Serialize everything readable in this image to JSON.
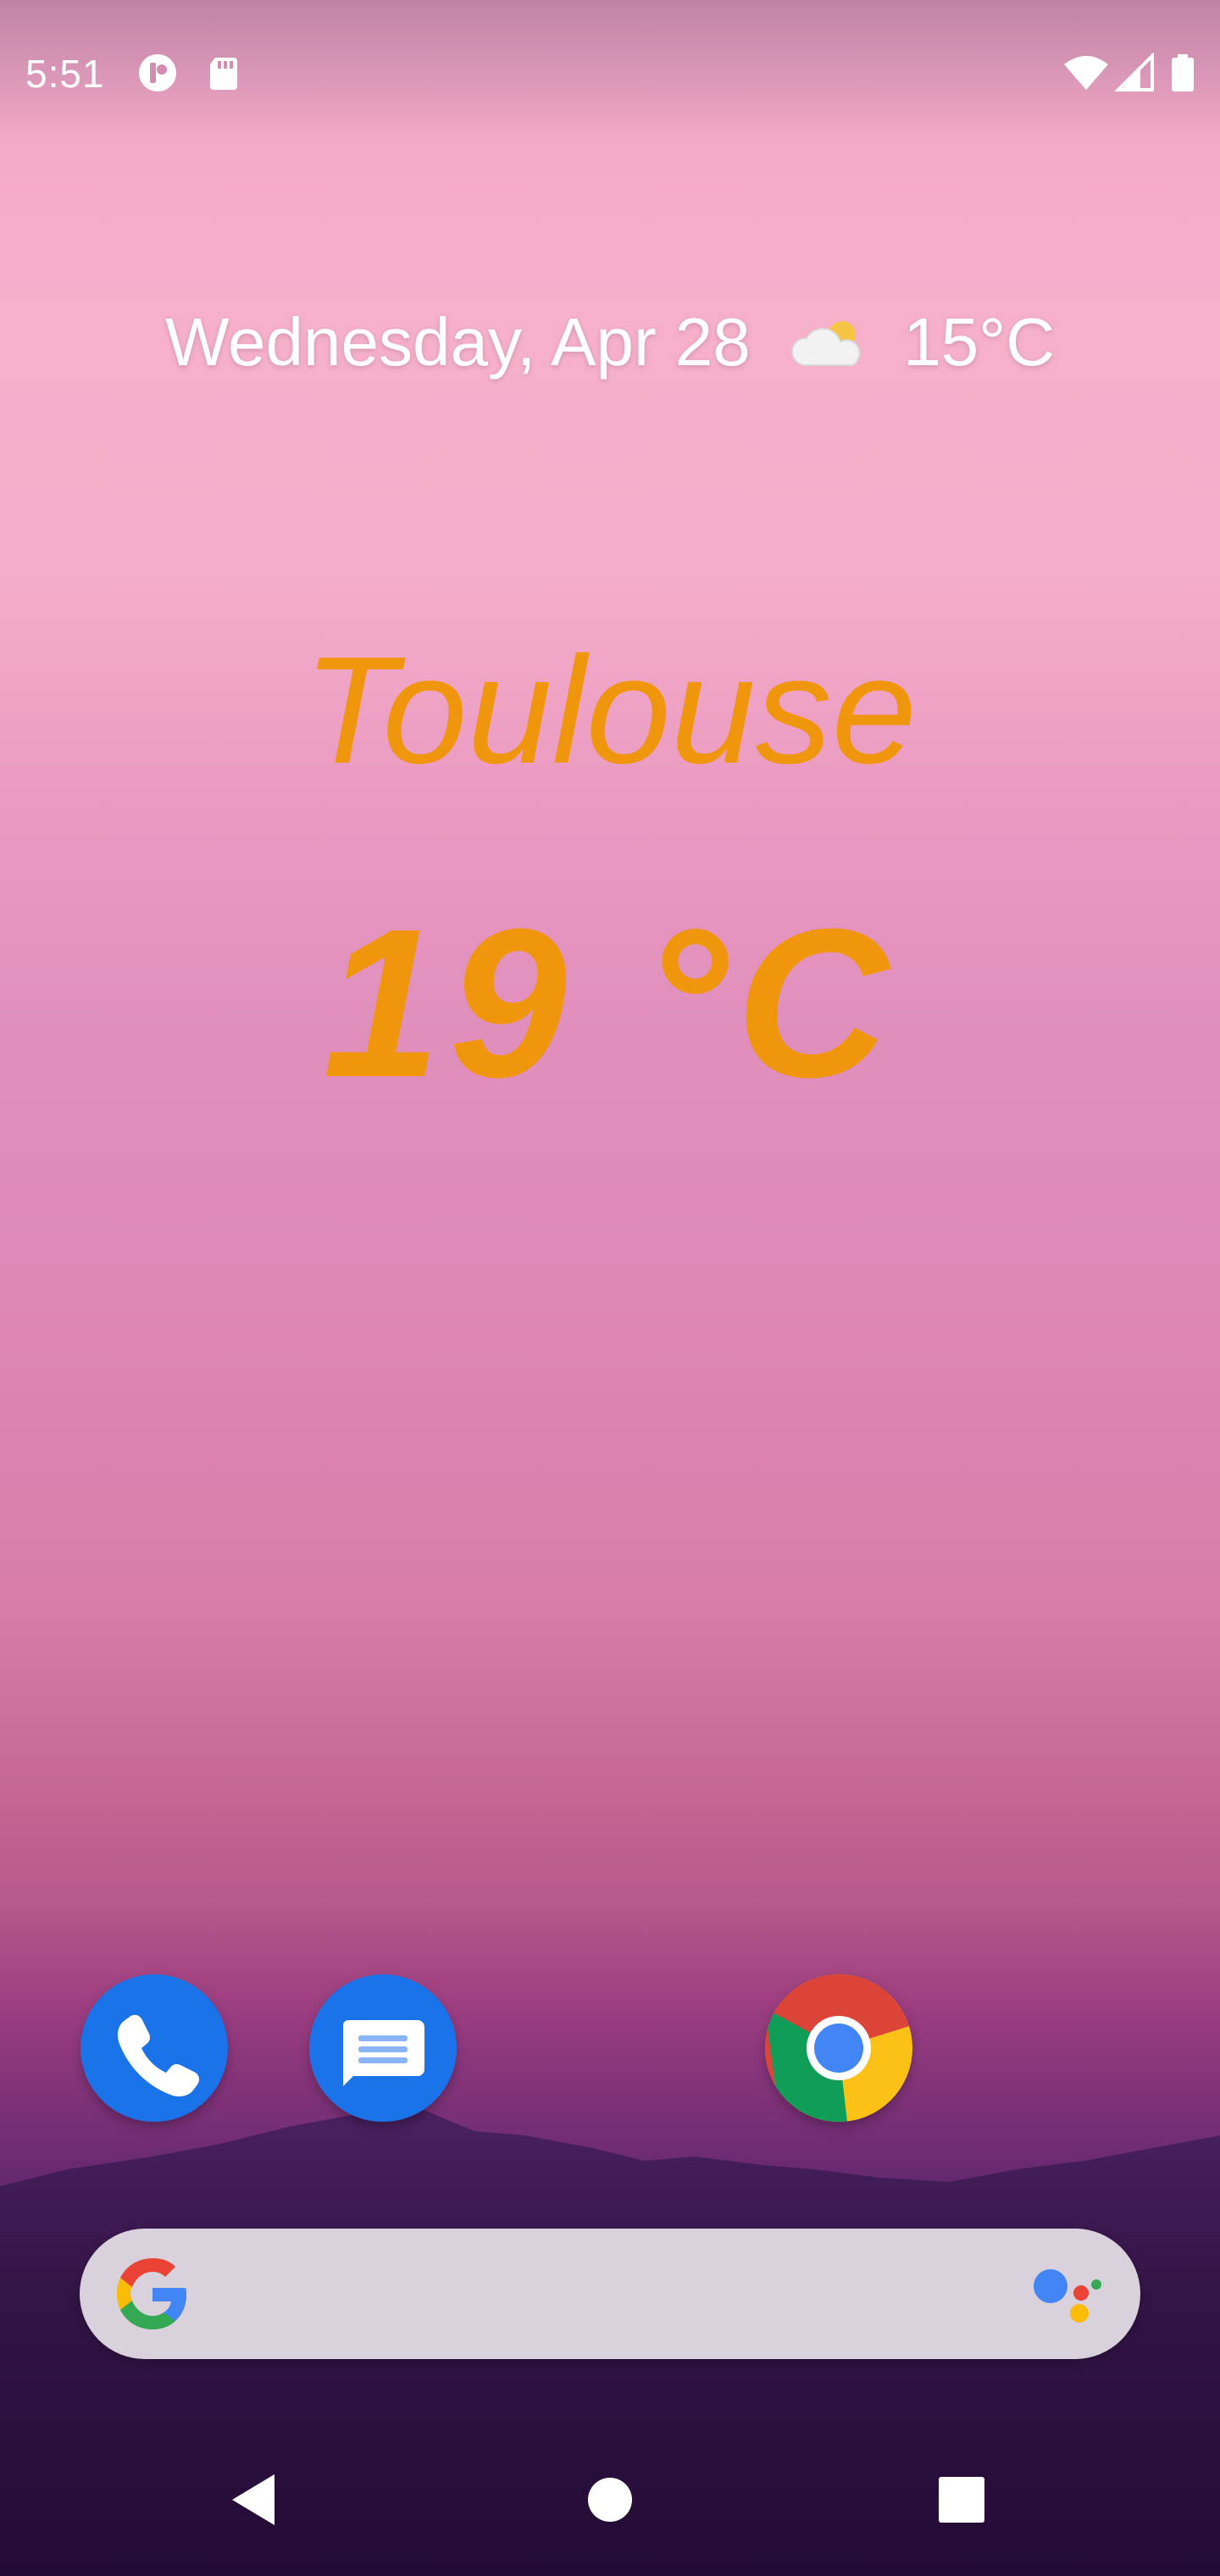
{
  "status_bar": {
    "time": "5:51",
    "left_icons": [
      "opera-notification-icon",
      "sd-card-icon"
    ],
    "right_icons": [
      "wifi-icon",
      "cell-signal-icon",
      "battery-icon"
    ]
  },
  "glance": {
    "date": "Wednesday, Apr 28",
    "weather_icon": "partly-cloudy-icon",
    "temperature": "15°C"
  },
  "weather_widget": {
    "city": "Toulouse",
    "temperature": "19 °C",
    "color": "#f0960c"
  },
  "dock": {
    "apps": [
      {
        "name": "Phone",
        "icon": "phone-icon",
        "color": "#1a73e8"
      },
      {
        "name": "Messages",
        "icon": "messages-icon",
        "color": "#1a73e8"
      },
      {
        "name": "Chrome",
        "icon": "chrome-icon"
      }
    ]
  },
  "search_bar": {
    "logo": "google-g-icon",
    "assistant": "google-assistant-icon"
  },
  "nav_bar": {
    "buttons": [
      "back-icon",
      "home-icon",
      "recents-icon"
    ]
  }
}
